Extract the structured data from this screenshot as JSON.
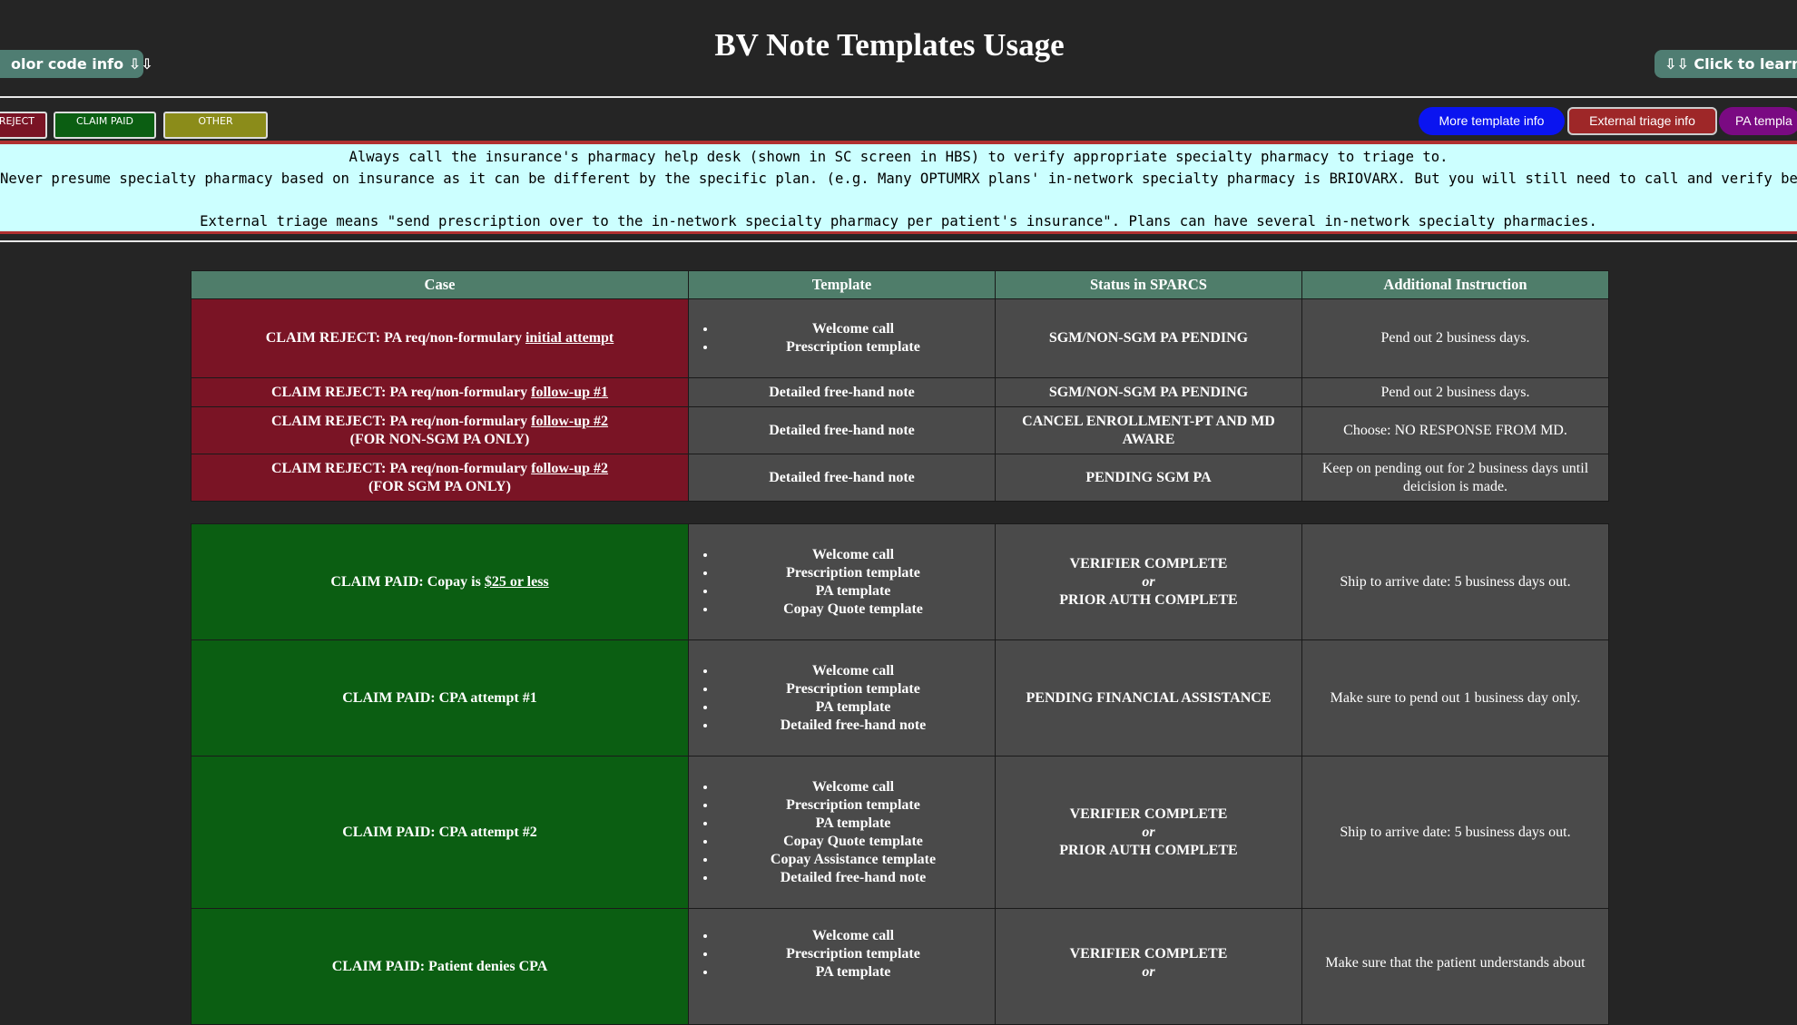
{
  "page": {
    "title": "BV Note Templates Usage"
  },
  "header": {
    "color_code_button": "olor code info ⇩⇩",
    "learn_more_button": "⇩⇩ Click to learn m"
  },
  "legend": {
    "reject": "REJECT",
    "claim_paid": "CLAIM PAID",
    "other": "OTHER"
  },
  "tabs": {
    "more_template": "More template info",
    "external_triage": "External triage info",
    "pa_template": "PA templa"
  },
  "notice": {
    "line1": "Always call the insurance's pharmacy help desk (shown in SC screen in HBS) to verify appropriate specialty pharmacy to triage to.",
    "line2": "Never presume specialty pharmacy based on insurance as it can be different by the specific plan. (e.g. Many OPTUMRX plans' in-network specialty pharmacy is BRIOVARX. But you will still need to call and verify before triaging.)",
    "line3": "External triage means \"send prescription over to the in-network specialty pharmacy per patient's insurance\". Plans can have several in-network specialty pharmacies."
  },
  "colors": {
    "reject": "#7a1425",
    "paid": "#0b5e12",
    "other": "#8b8c1a",
    "header": "#4f7d6a",
    "cell": "#4a4a4a",
    "notice": "#ccffff"
  },
  "table": {
    "headers": [
      "Case",
      "Template",
      "Status in SPARCS",
      "Additional Instruction"
    ],
    "reject_rows": [
      {
        "case_prefix": "CLAIM REJECT: PA req/non-formulary ",
        "case_link": "initial attempt",
        "case_suffix": "",
        "templates": [
          "Welcome call",
          "Prescription template"
        ],
        "status": "SGM/NON-SGM PA PENDING",
        "instruction": "Pend out 2 business days."
      },
      {
        "case_prefix": "CLAIM REJECT: PA req/non-formulary ",
        "case_link": "follow-up #1",
        "case_suffix": "",
        "template_text": "Detailed free-hand note",
        "status": "SGM/NON-SGM PA PENDING",
        "instruction": "Pend out 2 business days."
      },
      {
        "case_prefix": "CLAIM REJECT: PA req/non-formulary ",
        "case_link": "follow-up #2",
        "case_suffix": "(FOR NON-SGM PA ONLY)",
        "template_text": "Detailed free-hand note",
        "status": "CANCEL ENROLLMENT-PT AND MD AWARE",
        "instruction": "Choose: NO RESPONSE FROM MD."
      },
      {
        "case_prefix": "CLAIM REJECT: PA req/non-formulary ",
        "case_link": "follow-up #2",
        "case_suffix": "(FOR SGM PA ONLY)",
        "template_text": "Detailed free-hand note",
        "status": "PENDING SGM PA",
        "instruction": "Keep on pending out for 2 business days until deicision is made."
      }
    ],
    "paid_rows": [
      {
        "case_prefix": "CLAIM PAID: Copay is ",
        "case_link": "$25 or less",
        "templates": [
          "Welcome call",
          "Prescription template",
          "PA template",
          "Copay Quote template"
        ],
        "status_a": "VERIFIER COMPLETE",
        "status_or": "or",
        "status_b": "PRIOR AUTH COMPLETE",
        "instruction": "Ship to arrive date: 5 business days out."
      },
      {
        "case_prefix": "CLAIM PAID: CPA attempt #1",
        "case_link": "",
        "templates": [
          "Welcome call",
          "Prescription template",
          "PA template",
          "Detailed free-hand note"
        ],
        "status_a": "PENDING FINANCIAL ASSISTANCE",
        "status_or": "",
        "status_b": "",
        "instruction": "Make sure to pend out 1 business day only."
      },
      {
        "case_prefix": "CLAIM PAID: CPA attempt #2",
        "case_link": "",
        "templates": [
          "Welcome call",
          "Prescription template",
          "PA template",
          "Copay Quote template",
          "Copay Assistance template",
          "Detailed free-hand note"
        ],
        "status_a": "VERIFIER COMPLETE",
        "status_or": "or",
        "status_b": "PRIOR AUTH COMPLETE",
        "instruction": "Ship to arrive date: 5 business days out."
      },
      {
        "case_prefix": "CLAIM PAID: Patient denies CPA",
        "case_link": "",
        "templates": [
          "Welcome call",
          "Prescription template",
          "PA template"
        ],
        "status_a": "VERIFIER COMPLETE",
        "status_or": "or",
        "status_b": "",
        "instruction": "Make sure that the patient understands about"
      }
    ]
  }
}
